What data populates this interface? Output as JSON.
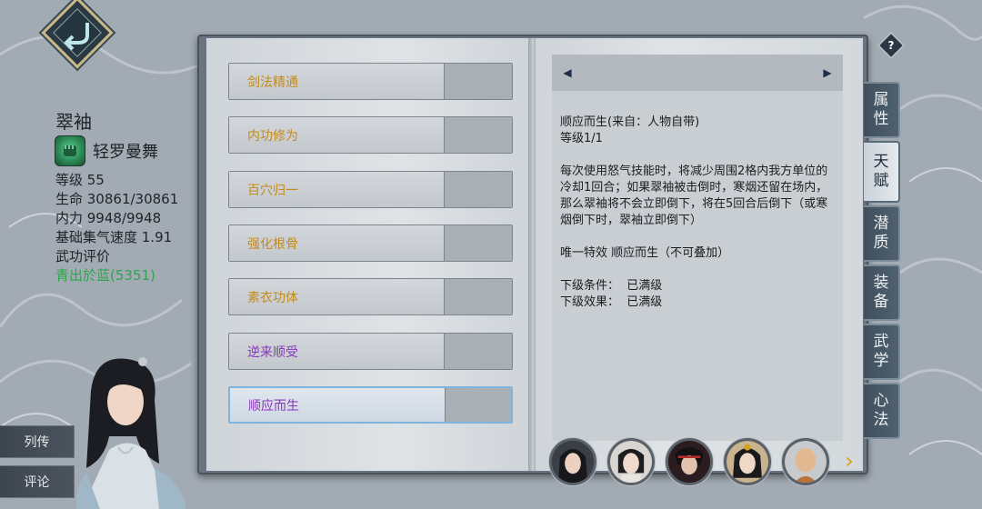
{
  "character": {
    "name": "翠袖",
    "style_name": "轻罗曼舞",
    "stats": [
      "等级 55",
      "生命 30861/30861",
      "内力 9948/9948",
      "基础集气速度 1.91",
      "武功评价"
    ],
    "rating": "青出於蓝(5351)"
  },
  "side_buttons": [
    "列传",
    "评论"
  ],
  "talents": [
    {
      "label": "剑法精通",
      "color": "#c48a1a"
    },
    {
      "label": "内功修为",
      "color": "#c48a1a"
    },
    {
      "label": "百穴归一",
      "color": "#c48a1a"
    },
    {
      "label": "强化根骨",
      "color": "#c48a1a"
    },
    {
      "label": "素衣功体",
      "color": "#c48a1a"
    },
    {
      "label": "逆来顺受",
      "color": "#8a36b8"
    },
    {
      "label": "顺应而生",
      "color": "#8a36b8"
    }
  ],
  "selected_talent_index": 6,
  "detail": {
    "text": "顺应而生(来自：人物自带)\n等级1/1\n\n每次使用怒气技能时，将减少周围2格内我方单位的冷却1回合；如果翠袖被击倒时，寒烟还留在场内，那么翠袖将不会立即倒下，将在5回合后倒下（或寒烟倒下时，翠袖立即倒下）\n\n唯一特效 顺应而生（不可叠加）\n\n下级条件：  已满级\n下级效果：  已满级"
  },
  "tabs": [
    {
      "label": "属性",
      "active": false
    },
    {
      "label": "天赋",
      "active": true
    },
    {
      "label": "潜质",
      "active": false
    },
    {
      "label": "装备",
      "active": false
    },
    {
      "label": "武学",
      "active": false
    },
    {
      "label": "心法",
      "active": false
    }
  ],
  "help_label": "?",
  "colors": {
    "gold": "#c48a1a",
    "purple": "#8a36b8",
    "green": "#2fa44e"
  }
}
